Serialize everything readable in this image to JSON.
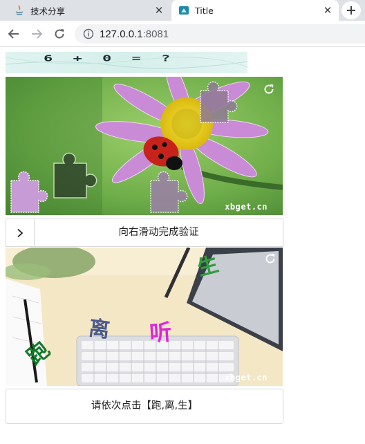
{
  "browser": {
    "tabs": [
      {
        "title": "技术分享",
        "favicon": "java-cup-icon",
        "active": false
      },
      {
        "title": "Title",
        "favicon": "app-logo-icon",
        "active": true
      }
    ],
    "close_glyph": "✕",
    "address": {
      "host": "127.0.0.1",
      "port": ":8081"
    }
  },
  "arithmetic_captcha": {
    "text": "6 + 0 = ?"
  },
  "slide_captcha": {
    "watermark": "xbget.cn",
    "instruction": "向右滑动完成验证",
    "handle_icon": "chevron-right-icon",
    "refresh_icon": "refresh-icon"
  },
  "click_captcha": {
    "watermark": "xbget.cn",
    "characters": [
      {
        "char": "生",
        "color": "#2e9e3e"
      },
      {
        "char": "离",
        "color": "#4a5a8c"
      },
      {
        "char": "听",
        "color": "#e025d8"
      },
      {
        "char": "跑",
        "color": "#157a2a"
      }
    ],
    "instruction": "请依次点击【跑,离,生】",
    "refresh_icon": "refresh-icon"
  }
}
